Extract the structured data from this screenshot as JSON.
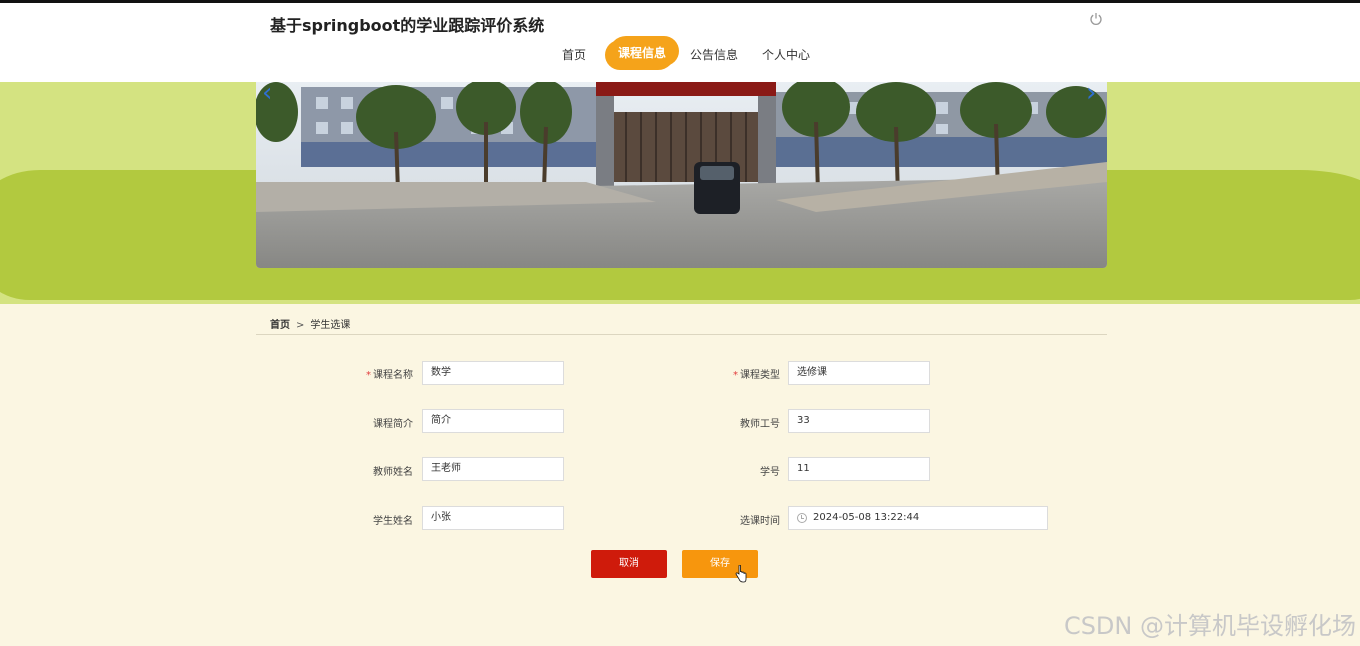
{
  "header": {
    "site_title": "基于springboot的学业跟踪评价系统",
    "nav": [
      {
        "label": "首页"
      },
      {
        "label": "课程信息",
        "active": true
      },
      {
        "label": "公告信息"
      },
      {
        "label": "个人中心"
      }
    ]
  },
  "banner": {
    "prev_arrow": "‹",
    "next_arrow": "›"
  },
  "breadcrumb": {
    "home": "首页",
    "separator": ">",
    "current": "学生选课"
  },
  "form": {
    "course_name": {
      "label": "课程名称",
      "required": true,
      "value": "数学"
    },
    "course_type": {
      "label": "课程类型",
      "required": true,
      "value": "选修课"
    },
    "course_intro": {
      "label": "课程简介",
      "value": "简介"
    },
    "teacher_id": {
      "label": "教师工号",
      "value": "33"
    },
    "teacher_name": {
      "label": "教师姓名",
      "value": "王老师"
    },
    "student_id": {
      "label": "学号",
      "value": "11"
    },
    "student_name": {
      "label": "学生姓名",
      "value": "小张"
    },
    "select_time": {
      "label": "选课时间",
      "value": "2024-05-08 13:22:44"
    },
    "required_mark": "*"
  },
  "buttons": {
    "cancel": "取消",
    "save": "保存"
  },
  "watermark": "CSDN @计算机毕设孵化场",
  "colors": {
    "accent": "#f5a31a",
    "cancel": "#cf1b0b",
    "save": "#f7960d",
    "band_light": "#d4e381",
    "band_dark": "#b2c93f",
    "page_bg": "#fbf6e2"
  }
}
